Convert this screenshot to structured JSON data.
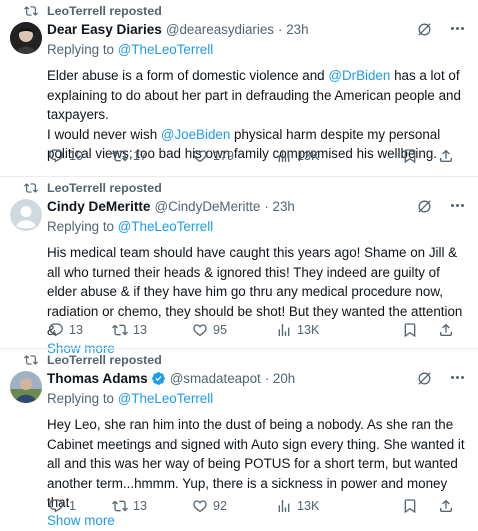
{
  "colors": {
    "accent": "#1d9bf0",
    "muted": "#536471",
    "text": "#0f1419"
  },
  "tweets": [
    {
      "reposted_by": "LeoTerrell reposted",
      "name": "Dear Easy Diaries",
      "handle": "@deareasydiaries",
      "time": "· 23h",
      "verified": false,
      "replying_prefix": "Replying to ",
      "replying_to": "@TheLeoTerrell",
      "body": {
        "p1_a": "Elder abuse is a form of domestic violence and ",
        "p1_mention": "@DrBiden",
        "p1_b": " has a lot of explaining to do about her part in defrauding the American people and taxpayers.",
        "p2_a": "I would never wish ",
        "p2_mention": "@JoeBiden",
        "p2_b": " physical harm despite my personal political views; too bad his own family compromised his wellbeing."
      },
      "show_more": "",
      "replies": "10",
      "reposts": "17",
      "likes": "179",
      "views": "13K"
    },
    {
      "reposted_by": "LeoTerrell reposted",
      "name": "Cindy DeMeritte",
      "handle": "@CindyDeMeritte",
      "time": "· 23h",
      "verified": false,
      "replying_prefix": "Replying to ",
      "replying_to": "@TheLeoTerrell",
      "body": {
        "text": "His medical team should have caught this years ago! Shame on Jill & all who turned their heads & ignored this! They indeed are guilty of elder abuse & if they have him go thru any medical procedure now, radiation or chemo, they should be shot! But they wanted the attention &"
      },
      "show_more": "Show more",
      "replies": "13",
      "reposts": "13",
      "likes": "95",
      "views": "13K"
    },
    {
      "reposted_by": "LeoTerrell reposted",
      "name": "Thomas Adams",
      "handle": "@smadateapot",
      "time": "· 20h",
      "verified": true,
      "replying_prefix": "Replying to ",
      "replying_to": "@TheLeoTerrell",
      "body": {
        "text": "Hey Leo, she ran him into the dust of being a nobody.  As she ran the Cabinet meetings and signed with Auto sign every thing.  She wanted it all and this was her way of being POTUS for a short term, but wanted another term...hmmm.  Yup, there is a sickness in power and money that"
      },
      "show_more": "Show more",
      "replies": "1",
      "reposts": "13",
      "likes": "92",
      "views": "13K"
    }
  ]
}
